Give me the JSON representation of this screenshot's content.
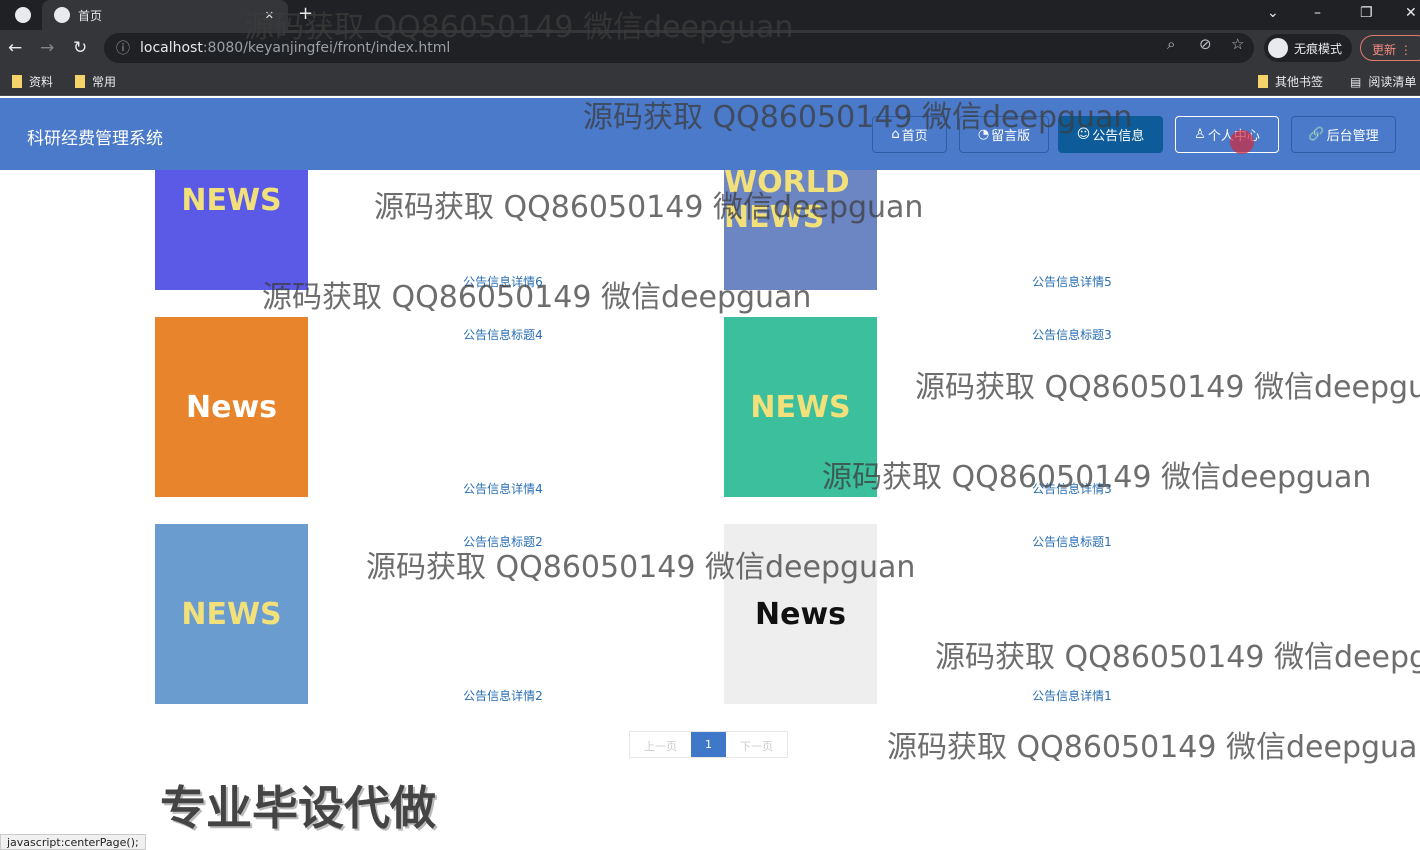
{
  "browser": {
    "tab_title": "首页",
    "url_host": "localhost",
    "url_path": ":8080/keyanjingfei/front/index.html",
    "incognito": "无痕模式",
    "update": "更新",
    "bookmarks": [
      "资料",
      "常用"
    ],
    "other_bookmarks": "其他书签",
    "reading_list": "阅读清单"
  },
  "header": {
    "title": "科研经费管理系统",
    "nav": [
      {
        "icon": "home-icon",
        "label": "首页"
      },
      {
        "icon": "gauge-icon",
        "label": "留言版"
      },
      {
        "icon": "smile-icon",
        "label": "公告信息"
      },
      {
        "icon": "user-icon",
        "label": "个人中心"
      },
      {
        "icon": "link-icon",
        "label": "后台管理"
      }
    ]
  },
  "news": [
    {
      "title": "公告信息标题6",
      "detail": "公告信息详情6",
      "image": "NEWS",
      "color": "#5a5ae6"
    },
    {
      "title": "公告信息标题5",
      "detail": "公告信息详情5",
      "image": "WORLD NEWS",
      "color": "#6c86c4"
    },
    {
      "title": "公告信息标题4",
      "detail": "公告信息详情4",
      "image": "News",
      "color": "#e8852c"
    },
    {
      "title": "公告信息标题3",
      "detail": "公告信息详情3",
      "image": "NEWS",
      "color": "#3cbf9c"
    },
    {
      "title": "公告信息标题2",
      "detail": "公告信息详情2",
      "image": "NEWS",
      "color": "#6a9ccf"
    },
    {
      "title": "公告信息标题1",
      "detail": "公告信息详情1",
      "image": "News",
      "color": "#eeeeee"
    }
  ],
  "pagination": {
    "prev": "上一页",
    "current": "1",
    "next": "下一页"
  },
  "watermark": "源码获取 QQ86050149 微信deepguan",
  "promo": "专业毕设代做",
  "status_bar": "javascript:centerPage();"
}
